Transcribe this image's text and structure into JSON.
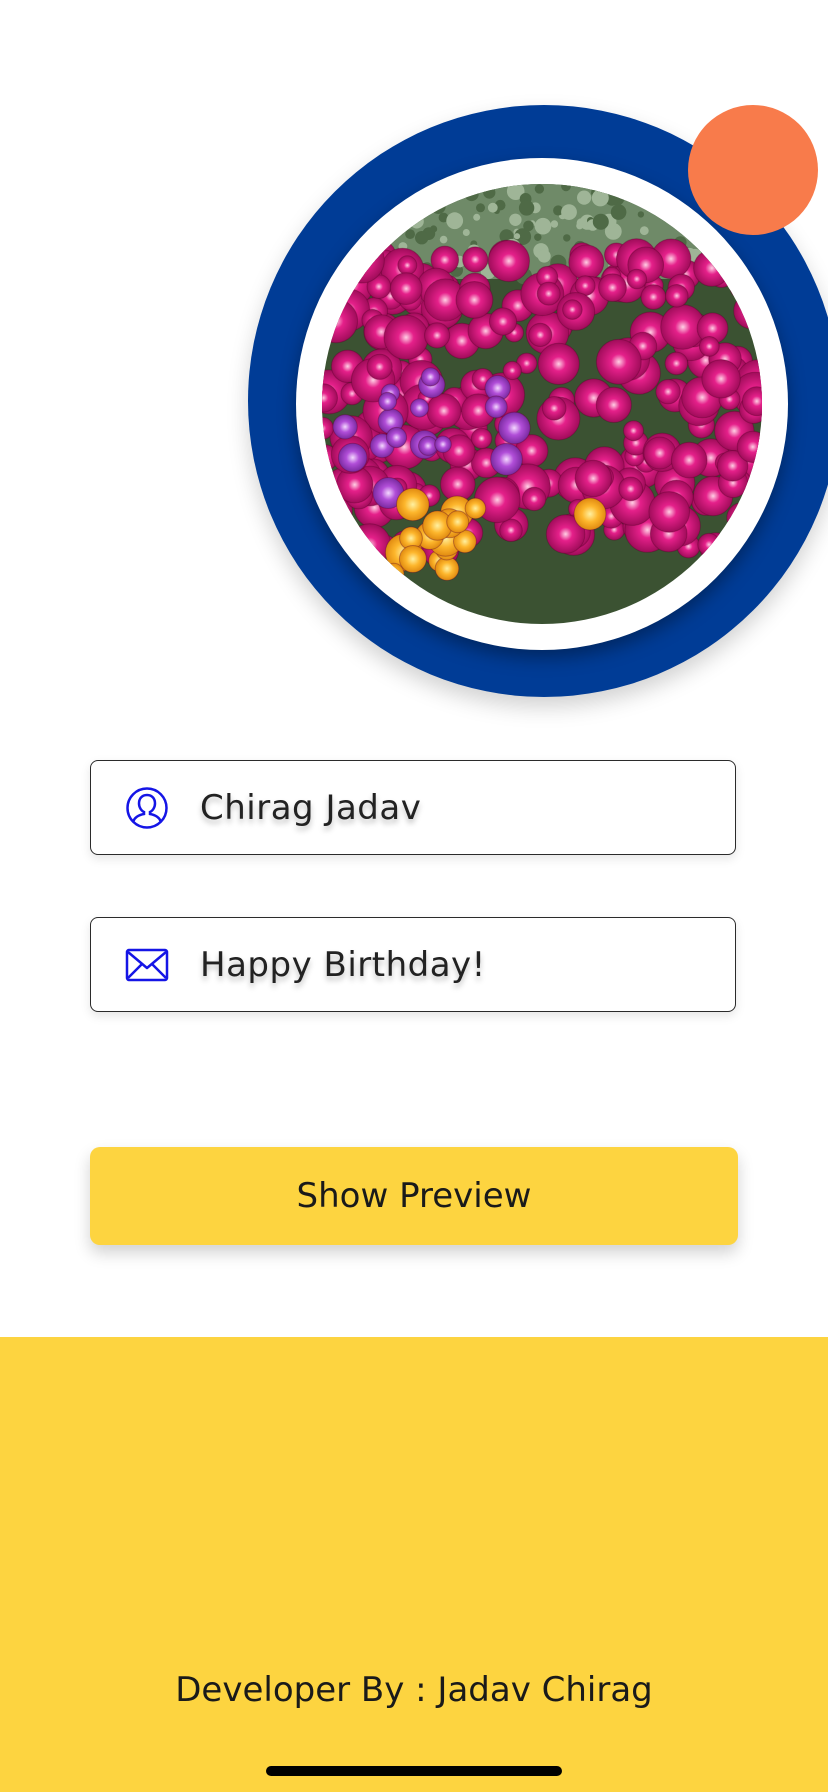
{
  "colors": {
    "ring": "#003C96",
    "accent_dot": "#F87B4B",
    "button": "#FDD440",
    "footer": "#FDD440",
    "icon": "#1515E6",
    "flower_magenta": "#D0127A",
    "flower_purple": "#B14ED8",
    "flower_yellow": "#FDB62C",
    "foliage": "#3E5A35"
  },
  "profile": {
    "image_icon": "flower-photo",
    "edit_icon": "accent-dot"
  },
  "form": {
    "name_icon": "user-icon",
    "name_value": "Chirag Jadav",
    "message_icon": "mail-icon",
    "message_value": "Happy Birthday!",
    "preview_label": "Show Preview"
  },
  "footer": {
    "credit": "Developer By : Jadav Chirag"
  }
}
